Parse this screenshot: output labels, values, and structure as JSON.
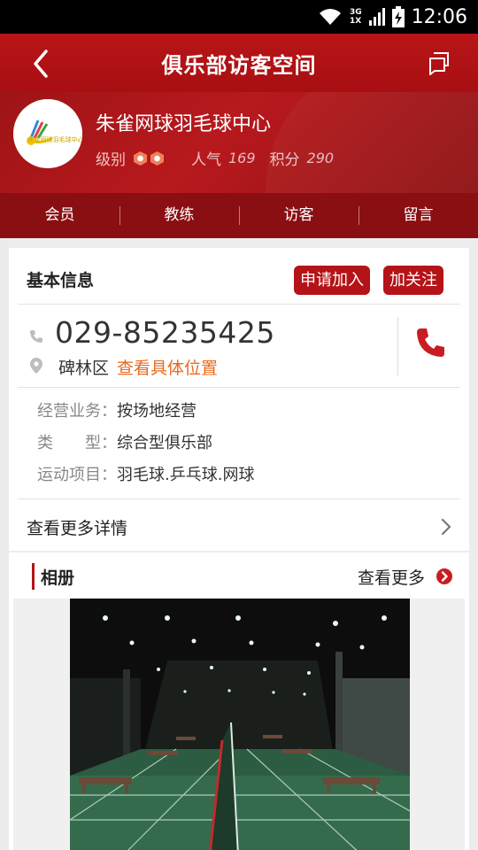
{
  "status_bar": {
    "time": "12:06",
    "network_top": "3G",
    "network_bottom": "1X"
  },
  "header": {
    "title": "俱乐部访客空间",
    "back_icon": "chevron-left-icon",
    "switch_icon": "switch-icon"
  },
  "profile": {
    "club_name": "朱雀网球羽毛球中心",
    "logo_text": "朱雀网球羽毛球中心",
    "level_label": "级别",
    "popularity_label": "人气",
    "popularity_value": "169",
    "points_label": "积分",
    "points_value": "290"
  },
  "tabs": [
    {
      "label": "会员"
    },
    {
      "label": "教练"
    },
    {
      "label": "访客"
    },
    {
      "label": "留言"
    }
  ],
  "basic_info": {
    "title": "基本信息",
    "join_button": "申请加入",
    "follow_button": "加关注",
    "phone": "029-85235425",
    "district": "碑林区",
    "view_location": "查看具体位置",
    "details": [
      {
        "label": "经营业务：",
        "value": "按场地经营"
      },
      {
        "label": "类　　型：",
        "value": "综合型俱乐部"
      },
      {
        "label": "运动项目：",
        "value": "羽毛球.乒乓球.网球"
      }
    ],
    "more_details": "查看更多详情"
  },
  "album": {
    "title": "相册",
    "more": "查看更多"
  },
  "colors": {
    "brand_red": "#b41317",
    "link_orange": "#e86a1f"
  }
}
